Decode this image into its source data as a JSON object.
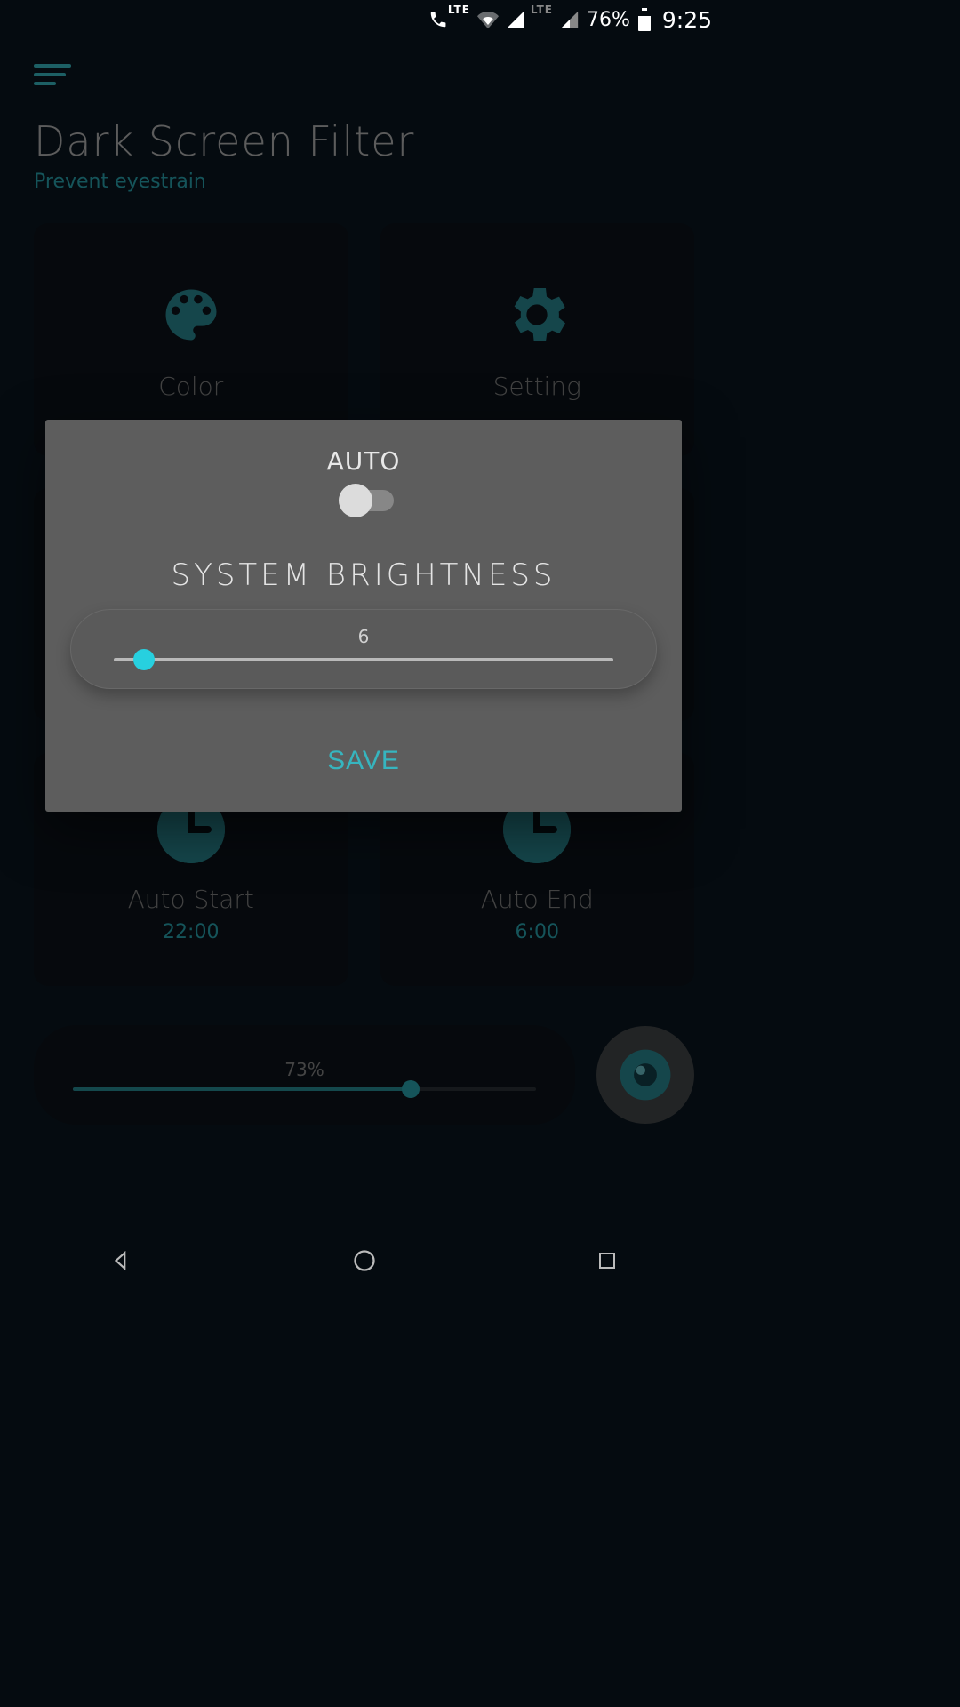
{
  "status": {
    "network1_label": "LTE",
    "network2_label": "LTE",
    "battery_pct": "76%",
    "time": "9:25"
  },
  "app": {
    "title": "Dark Screen Filter",
    "subtitle": "Prevent eyestrain",
    "cards": {
      "color": "Color",
      "setting": "Setting",
      "auto_start": "Auto Start",
      "auto_start_time": "22:00",
      "auto_end": "Auto End",
      "auto_end_time": "6:00"
    },
    "intensity": {
      "label": "73%",
      "percent": 73
    }
  },
  "dialog": {
    "auto_label": "AUTO",
    "auto_on": false,
    "heading": "SYSTEM BRIGHTNESS",
    "value": "6",
    "value_pct": 6,
    "save_label": "SAVE"
  },
  "colors": {
    "accent": "#2aa9b3",
    "accent_bright": "#27d0df"
  }
}
